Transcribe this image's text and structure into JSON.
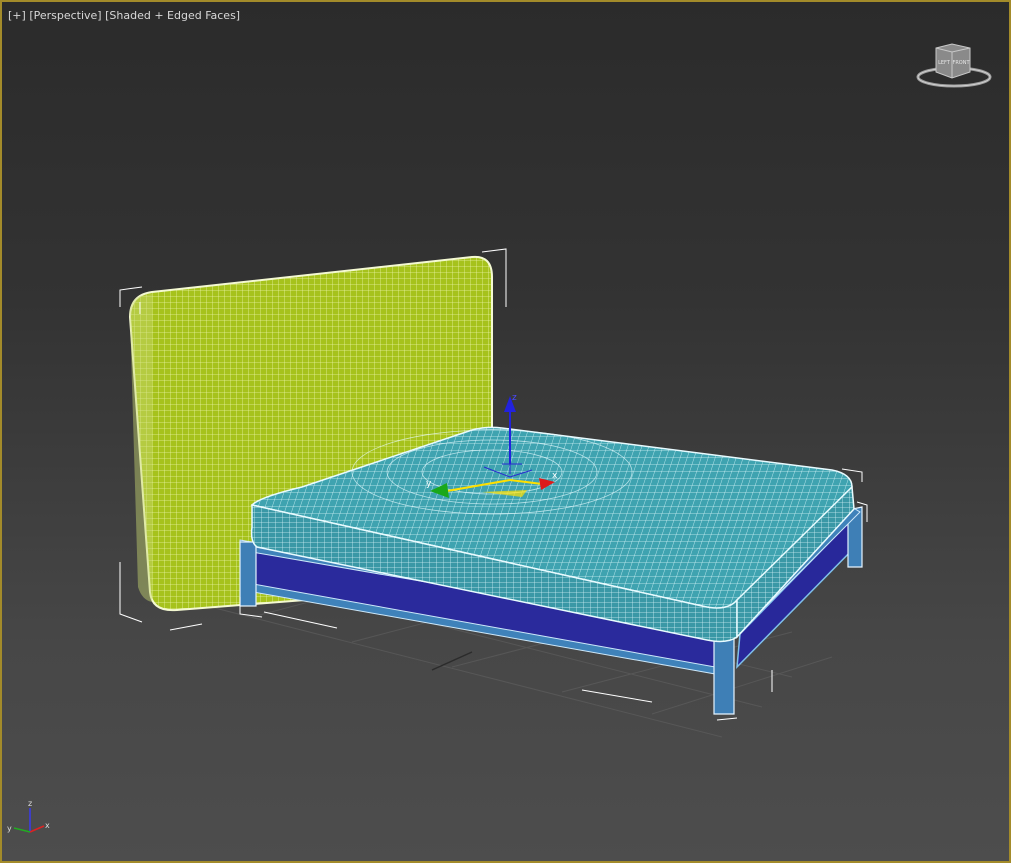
{
  "viewport": {
    "menu_plus": "[+]",
    "menu_view": "[Perspective]",
    "menu_shading": "[Shaded + Edged Faces]",
    "border_color": "#a38b2a"
  },
  "viewcube": {
    "left_label": "LEFT",
    "front_label": "FRONT"
  },
  "gizmo": {
    "z_label": "z",
    "x_label": "x",
    "y_label": "y"
  },
  "axis_tripod": {
    "z_label": "z",
    "x_label": "x",
    "y_label": "y"
  },
  "colors": {
    "headboard": "#a8c41a",
    "mattress": "#40a8b4",
    "frame_panel": "#28289a",
    "frame_edge": "#3a7fb8",
    "selection_bracket": "#ffffff"
  }
}
